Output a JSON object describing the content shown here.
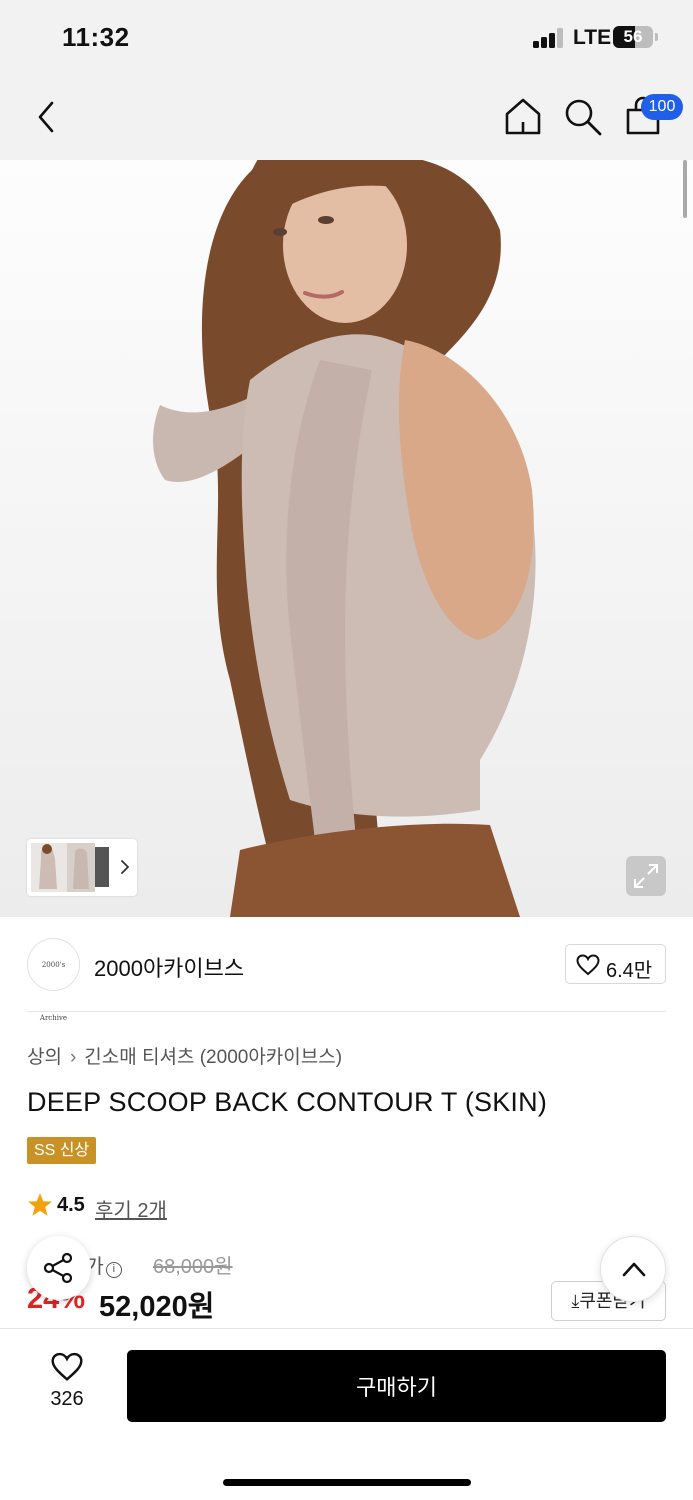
{
  "status_bar": {
    "time": "11:32",
    "network": "LTE",
    "battery": "56"
  },
  "nav": {
    "cart_count": "100",
    "icons": [
      "back-icon",
      "home-icon",
      "search-icon",
      "cart-icon"
    ]
  },
  "gallery": {
    "icons": [
      "expand-icon",
      "chevron-right-icon"
    ]
  },
  "brand": {
    "logo_text": "2000's Archive",
    "name": "2000아카이브스",
    "likes": "6.4만"
  },
  "breadcrumb": {
    "category": "상의",
    "subcategory": "긴소매 티셔츠 (2000아카이브스)"
  },
  "product": {
    "title": "DEEP SCOOP BACK CONTOUR T (SKIN)",
    "tag": "SS 신상"
  },
  "rating": {
    "score": "4.5",
    "reviews": "후기 2개"
  },
  "price": {
    "label": "정가",
    "original": "68,000원",
    "discount": "24%",
    "sale": "52,020원",
    "coupon_button": "쿠폰받기"
  },
  "bottom_bar": {
    "wish_count": "326",
    "buy_button": "구매하기"
  },
  "colors": {
    "accent_blue": "#1f5fea",
    "tag_gold": "#c99227",
    "discount_red": "#e02424",
    "star": "#f2a20d"
  }
}
